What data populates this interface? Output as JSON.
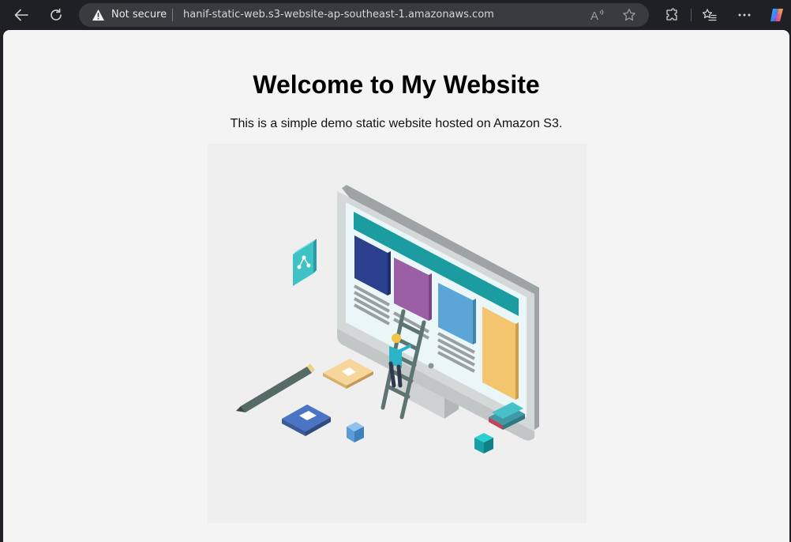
{
  "browser": {
    "security_label": "Not secure",
    "url": "hanif-static-web.s3-website-ap-southeast-1.amazonaws.com",
    "icons": {
      "back": "back-arrow-icon",
      "refresh": "refresh-icon",
      "warning": "warning-icon",
      "read_aloud": "read-aloud-icon",
      "favorite": "star-icon",
      "extensions": "extensions-icon",
      "favorites": "favorites-icon",
      "menu": "more-icon",
      "copilot": "copilot-icon"
    }
  },
  "page": {
    "title": "Welcome to My Website",
    "subtitle": "This is a simple demo static website hosted on Amazon S3.",
    "hero_image": "isometric illustration of a person on a ladder building a web page on a desktop monitor"
  },
  "colors": {
    "browser_chrome": "#1f2024",
    "omnibox": "#3a3b3f",
    "page_background": "#f4f4f4",
    "hero_background": "#efefef",
    "teal": "#1aa3a3"
  }
}
